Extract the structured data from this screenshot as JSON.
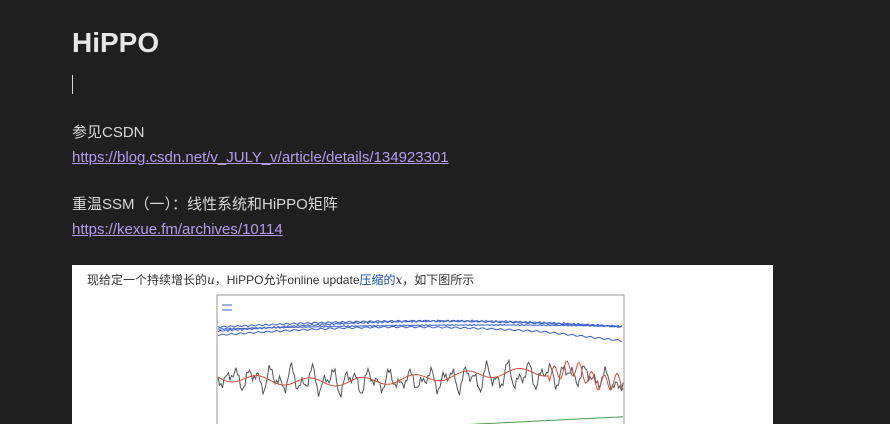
{
  "document": {
    "title": "HiPPO"
  },
  "sections": [
    {
      "heading": "参见CSDN",
      "link": "https://blog.csdn.net/v_JULY_v/article/details/134923301"
    },
    {
      "heading": "重温SSM（一）：线性系统和HiPPO矩阵",
      "link": "https://kexue.fm/archives/10114"
    }
  ],
  "figure": {
    "caption_prefix": "现给定一个持续增长的",
    "caption_var_u": "u",
    "caption_mid": "，HiPPO允许online update",
    "caption_highlight": "压缩的",
    "caption_var_x": "x",
    "caption_suffix": "，如下图所示"
  },
  "colors": {
    "background": "#1f1f1f",
    "text": "#d8d8d8",
    "link": "#b49cf0",
    "figure_bg": "#ffffff",
    "blue_series": "#3a5fd0",
    "red_series": "#d0503a",
    "gray_series": "#555555",
    "green_series": "#4a9a4a"
  }
}
